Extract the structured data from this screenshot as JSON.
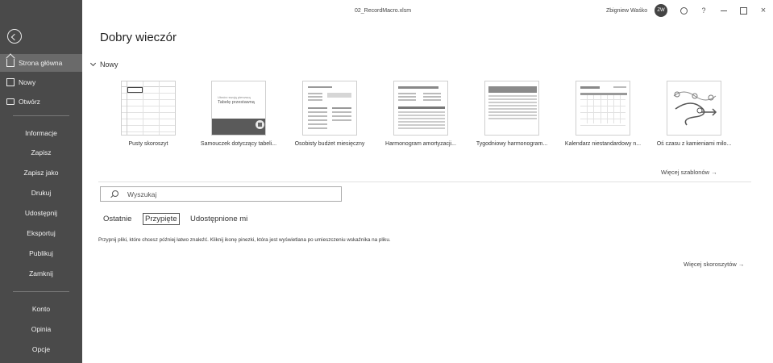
{
  "window": {
    "filename": "02_RecordMacro.xlsm",
    "username": "Zbigniew Waśko",
    "avatar_initials": "ZW",
    "help_label": "?",
    "close_label": "×"
  },
  "sidebar": {
    "top_items": [
      {
        "label": "Strona główna",
        "icon": "home-icon",
        "active": true
      },
      {
        "label": "Nowy",
        "icon": "new-document-icon"
      },
      {
        "label": "Otwórz",
        "icon": "folder-icon"
      }
    ],
    "mid_items": [
      {
        "label": "Informacje"
      },
      {
        "label": "Zapisz"
      },
      {
        "label": "Zapisz jako"
      },
      {
        "label": "Drukuj"
      },
      {
        "label": "Udostępnij"
      },
      {
        "label": "Eksportuj"
      },
      {
        "label": "Publikuj"
      },
      {
        "label": "Zamknij"
      }
    ],
    "bottom_items": [
      {
        "label": "Konto"
      },
      {
        "label": "Opinia"
      },
      {
        "label": "Opcje"
      }
    ]
  },
  "main": {
    "greeting": "Dobry wieczór",
    "new_section_label": "Nowy",
    "templates": [
      {
        "label": "Pusty skoroszyt"
      },
      {
        "label": "Samouczek dotyczący tabeli...",
        "thumb_text_1": "Utwórz swoją pierwszą",
        "thumb_text_2": "Tabelę przestawną"
      },
      {
        "label": "Osobisty budżet miesięczny"
      },
      {
        "label": "Harmonogram amortyzacji..."
      },
      {
        "label": "Tygodniowy harmonogram..."
      },
      {
        "label": "Kalendarz niestandardowy n..."
      },
      {
        "label": "Oś czasu z kamieniami milo..."
      }
    ],
    "more_templates_label": "Więcej szablonów →",
    "search_placeholder": "Wyszukaj",
    "tabs": [
      {
        "label": "Ostatnie"
      },
      {
        "label": "Przypięte",
        "selected": true
      },
      {
        "label": "Udostępnione mi"
      }
    ],
    "pinned_info_text": "Przypnij pliki, które chcesz później łatwo znaleźć. Kliknij ikonę pinezki, która jest wyświetlana po umieszczeniu wskaźnika na pliku.",
    "more_documents_label": "Więcej skoroszytów →"
  },
  "colors": {
    "sidebar_bg": "#4a4a4a",
    "sidebar_active": "#6a6a6a",
    "text": "#333333"
  }
}
